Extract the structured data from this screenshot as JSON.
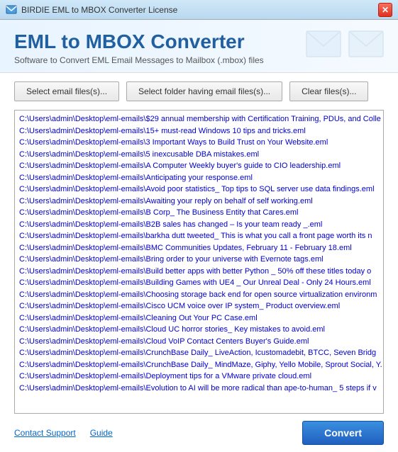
{
  "titleBar": {
    "title": "BIRDIE EML to MBOX Converter License",
    "closeLabel": "✕"
  },
  "header": {
    "appTitle": "EML to MBOX Converter",
    "subtitle": "Software to Convert EML Email Messages to Mailbox (.mbox) files"
  },
  "buttons": {
    "selectFiles": "Select email files(s)...",
    "selectFolder": "Select folder having email files(s)...",
    "clearFiles": "Clear files(s)..."
  },
  "fileList": [
    "C:\\Users\\admin\\Desktop\\eml-emails\\$29 annual membership with Certification Training, PDUs, and Colle",
    "C:\\Users\\admin\\Desktop\\eml-emails\\15+ must-read Windows 10 tips and tricks.eml",
    "C:\\Users\\admin\\Desktop\\eml-emails\\3 Important Ways to Build Trust on Your Website.eml",
    "C:\\Users\\admin\\Desktop\\eml-emails\\5 inexcusable DBA mistakes.eml",
    "C:\\Users\\admin\\Desktop\\eml-emails\\A Computer Weekly buyer's guide to CIO leadership.eml",
    "C:\\Users\\admin\\Desktop\\eml-emails\\Anticipating your response.eml",
    "C:\\Users\\admin\\Desktop\\eml-emails\\Avoid poor statistics_ Top tips to SQL server use data findings.eml",
    "C:\\Users\\admin\\Desktop\\eml-emails\\Awaiting your reply on behalf of self working.eml",
    "C:\\Users\\admin\\Desktop\\eml-emails\\B Corp_ The Business Entity that Cares.eml",
    "C:\\Users\\admin\\Desktop\\eml-emails\\B2B sales has changed – Is your team ready _.eml",
    "C:\\Users\\admin\\Desktop\\eml-emails\\barkha dutt tweeted_ This is what you call a front page worth its n",
    "C:\\Users\\admin\\Desktop\\eml-emails\\BMC Communities Updates, February 11 - February 18.eml",
    "C:\\Users\\admin\\Desktop\\eml-emails\\Bring order to your universe with Evernote tags.eml",
    "C:\\Users\\admin\\Desktop\\eml-emails\\Build better apps with better Python _ 50% off these titles today o",
    "C:\\Users\\admin\\Desktop\\eml-emails\\Building Games with UE4 _ Our Unreal Deal - Only 24 Hours.eml",
    "C:\\Users\\admin\\Desktop\\eml-emails\\Choosing storage back end for open source virtualization environm",
    "C:\\Users\\admin\\Desktop\\eml-emails\\Cisco UCM voice over IP system_ Product overview.eml",
    "C:\\Users\\admin\\Desktop\\eml-emails\\Cleaning Out Your PC Case.eml",
    "C:\\Users\\admin\\Desktop\\eml-emails\\Cloud UC horror stories_ Key mistakes to avoid.eml",
    "C:\\Users\\admin\\Desktop\\eml-emails\\Cloud VoIP Contact Centers Buyer's Guide.eml",
    "C:\\Users\\admin\\Desktop\\eml-emails\\CrunchBase Daily_ LiveAction, Icustomadebit, BTCC, Seven Bridg",
    "C:\\Users\\admin\\Desktop\\eml-emails\\CrunchBase Daily_ MindMaze, Giphy, Yello Mobile, Sprout Social, Y.",
    "C:\\Users\\admin\\Desktop\\eml-emails\\Deployment tips for a VMware private cloud.eml",
    "C:\\Users\\admin\\Desktop\\eml-emails\\Evolution to AI will be more radical than ape-to-human_ 5 steps if v"
  ],
  "footer": {
    "contactSupport": "Contact Support",
    "guide": "Guide",
    "convertButton": "Convert"
  }
}
